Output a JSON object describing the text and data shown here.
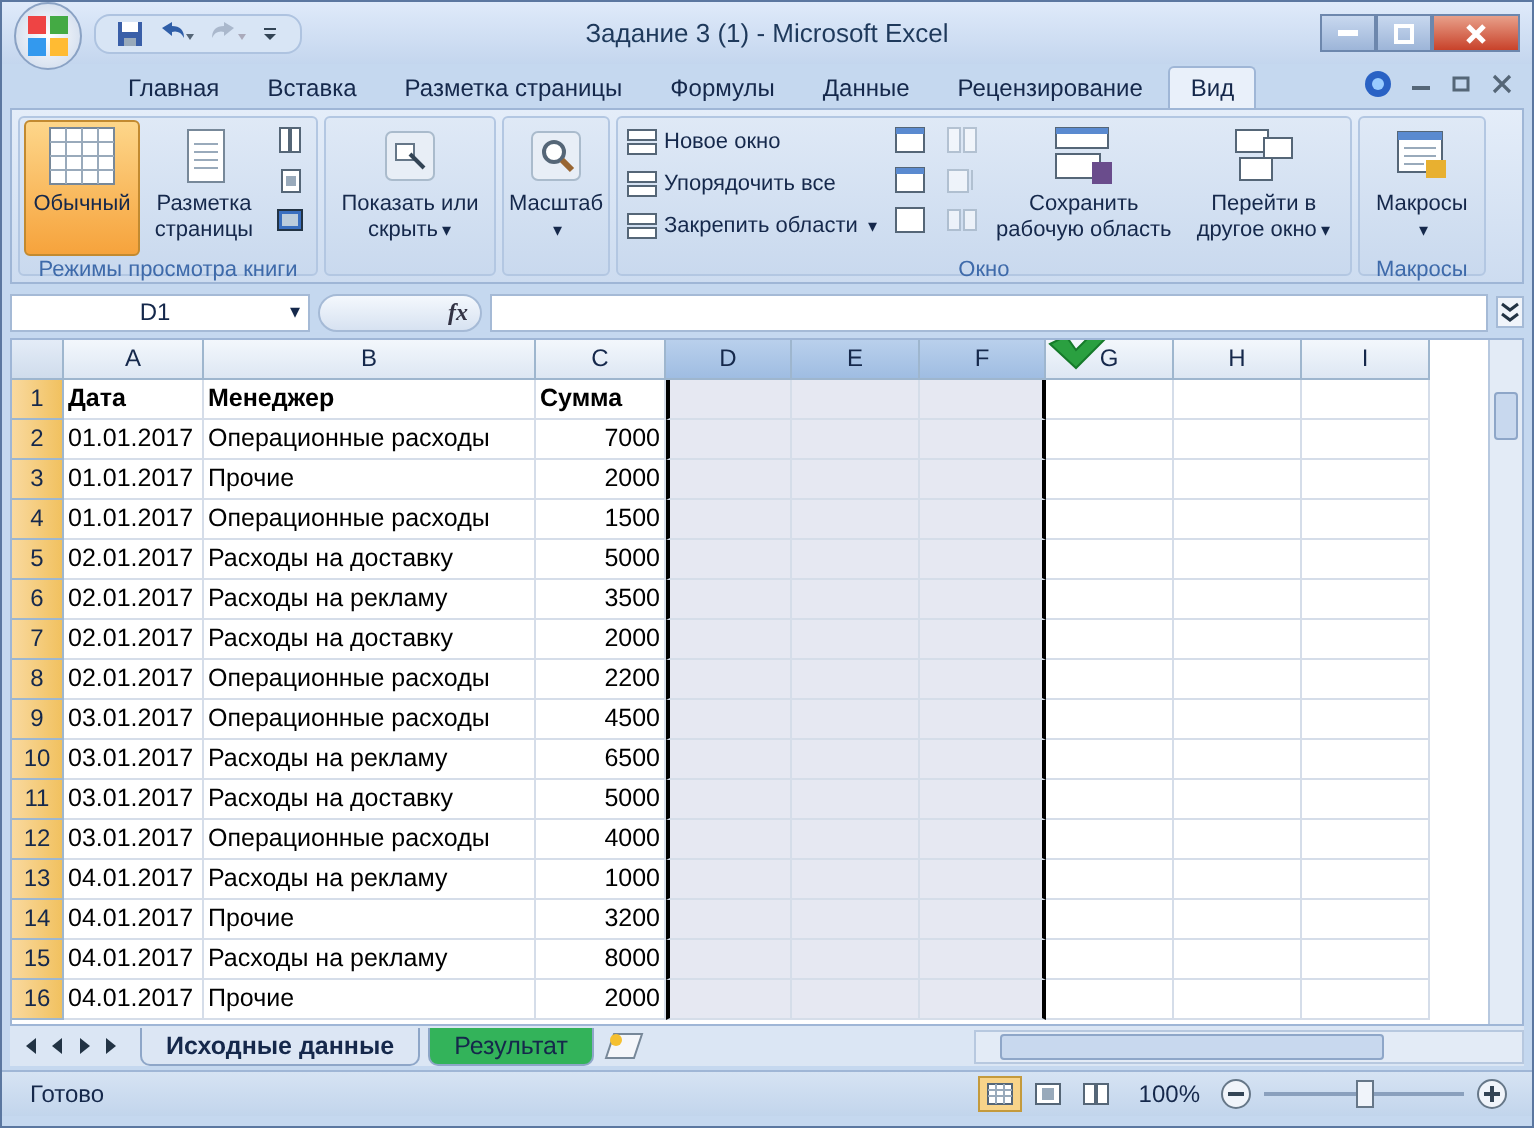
{
  "window": {
    "title": "Задание 3 (1) - Microsoft Excel"
  },
  "ribbon_tabs": [
    {
      "label": "Главная",
      "selected": false
    },
    {
      "label": "Вставка",
      "selected": false
    },
    {
      "label": "Разметка страницы",
      "selected": false
    },
    {
      "label": "Формулы",
      "selected": false
    },
    {
      "label": "Данные",
      "selected": false
    },
    {
      "label": "Рецензирование",
      "selected": false
    },
    {
      "label": "Вид",
      "selected": true
    }
  ],
  "ribbon": {
    "views": {
      "label": "Режимы просмотра книги",
      "normal": {
        "label": "Обычный",
        "selected": true
      },
      "page_layout": {
        "label": "Разметка страницы",
        "selected": false
      }
    },
    "show": {
      "label": "Показать или скрыть",
      "caret": "▾"
    },
    "zoom": {
      "label": "Масштаб",
      "caret": "▾"
    },
    "window_group": {
      "label": "Окно",
      "small": [
        {
          "label": "Новое окно"
        },
        {
          "label": "Упорядочить все"
        },
        {
          "label": "Закрепить области",
          "caret": "▾"
        }
      ],
      "save": {
        "label": "Сохранить рабочую область"
      },
      "switch": {
        "label": "Перейти в другое окно",
        "caret": "▾"
      }
    },
    "macros": {
      "label": "Макросы",
      "button": "Макросы",
      "caret": "▾"
    }
  },
  "formula_bar": {
    "name_box": "D1",
    "name_box_caret": "▾",
    "fx": "fx"
  },
  "columns": [
    {
      "label": "A",
      "selected": false
    },
    {
      "label": "B",
      "selected": false
    },
    {
      "label": "C",
      "selected": false
    },
    {
      "label": "D",
      "selected": true
    },
    {
      "label": "E",
      "selected": true
    },
    {
      "label": "F",
      "selected": true
    },
    {
      "label": "G",
      "selected": false
    },
    {
      "label": "H",
      "selected": false
    },
    {
      "label": "I",
      "selected": false
    }
  ],
  "rows": [
    {
      "number": "1",
      "kind": "header",
      "cells": [
        "Дата",
        "Менеджер",
        "Сумма"
      ]
    },
    {
      "number": "2",
      "kind": "data",
      "cells": [
        "01.01.2017",
        "Операционные расходы",
        "7000"
      ]
    },
    {
      "number": "3",
      "kind": "data",
      "cells": [
        "01.01.2017",
        "Прочие",
        "2000"
      ]
    },
    {
      "number": "4",
      "kind": "data",
      "cells": [
        "01.01.2017",
        "Операционные расходы",
        "1500"
      ]
    },
    {
      "number": "5",
      "kind": "data",
      "cells": [
        "02.01.2017",
        "Расходы на доставку",
        "5000"
      ]
    },
    {
      "number": "6",
      "kind": "data",
      "cells": [
        "02.01.2017",
        "Расходы на рекламу",
        "3500"
      ]
    },
    {
      "number": "7",
      "kind": "data",
      "cells": [
        "02.01.2017",
        "Расходы на доставку",
        "2000"
      ]
    },
    {
      "number": "8",
      "kind": "data",
      "cells": [
        "02.01.2017",
        "Операционные расходы",
        "2200"
      ]
    },
    {
      "number": "9",
      "kind": "data",
      "cells": [
        "03.01.2017",
        "Операционные расходы",
        "4500"
      ]
    },
    {
      "number": "10",
      "kind": "data",
      "cells": [
        "03.01.2017",
        "Расходы на рекламу",
        "6500"
      ]
    },
    {
      "number": "11",
      "kind": "data",
      "cells": [
        "03.01.2017",
        "Расходы на доставку",
        "5000"
      ]
    },
    {
      "number": "12",
      "kind": "data",
      "cells": [
        "03.01.2017",
        "Операционные расходы",
        "4000"
      ]
    },
    {
      "number": "13",
      "kind": "data",
      "cells": [
        "04.01.2017",
        "Расходы на рекламу",
        "1000"
      ]
    },
    {
      "number": "14",
      "kind": "data",
      "cells": [
        "04.01.2017",
        "Прочие",
        "3200"
      ]
    },
    {
      "number": "15",
      "kind": "data",
      "cells": [
        "04.01.2017",
        "Расходы на рекламу",
        "8000"
      ]
    },
    {
      "number": "16",
      "kind": "data",
      "cells": [
        "04.01.2017",
        "Прочие",
        "2000"
      ]
    }
  ],
  "sheet_tabs": [
    {
      "label": "Исходные данные",
      "selected": true,
      "color": "#dce6f4"
    },
    {
      "label": "Результат",
      "selected": false,
      "color": "#33b35a"
    }
  ],
  "status_bar": {
    "status": "Готово",
    "view": [
      {
        "selected": true
      },
      {
        "selected": false
      },
      {
        "selected": false
      }
    ],
    "zoom": "100%",
    "zoom_slider": {
      "level": 0.5
    }
  }
}
